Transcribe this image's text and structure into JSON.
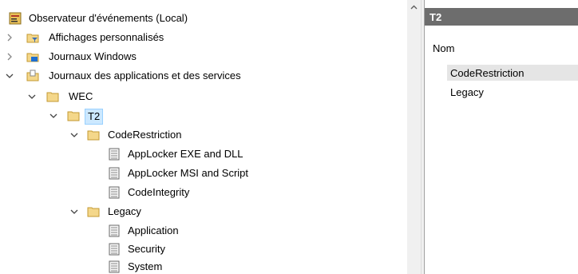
{
  "tree": {
    "root": "Observateur d'événements (Local)",
    "custom_views": "Affichages personnalisés",
    "windows_logs": "Journaux Windows",
    "app_service_logs": "Journaux des applications et des services",
    "wec": "WEC",
    "t2": "T2",
    "code_restriction": "CodeRestriction",
    "applocker_exe": "AppLocker EXE and DLL",
    "applocker_msi": "AppLocker MSI and Script",
    "code_integrity": "CodeIntegrity",
    "legacy": "Legacy",
    "application": "Application",
    "security": "Security",
    "system": "System"
  },
  "right_pane": {
    "title": "T2",
    "column_header": "Nom",
    "items": [
      "CodeRestriction",
      "Legacy"
    ]
  },
  "colors": {
    "header_bg": "#6d6d6d",
    "selection": "#cce8ff",
    "folder": "#f4d78a"
  }
}
